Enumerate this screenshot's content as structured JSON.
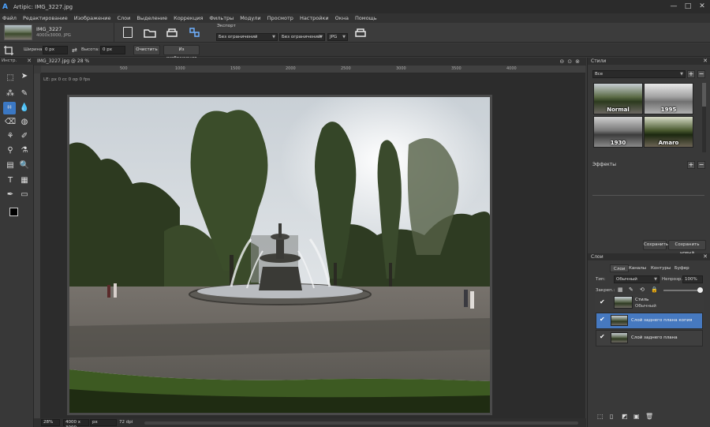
{
  "window": {
    "title": "Artipic: IMG_3227.jpg",
    "controls": [
      "—",
      "□",
      "✕"
    ]
  },
  "menu": [
    "Файл",
    "Редактирование",
    "Изображение",
    "Слои",
    "Выделение",
    "Коррекция",
    "Фильтры",
    "Модули",
    "Просмотр",
    "Настройки",
    "Окна",
    "Помощь"
  ],
  "topbar": {
    "thumb_name": "IMG_3227",
    "thumb_info": "4000x3000, JPG",
    "export_label": "Экспорт",
    "export_size1": "Без ограничений",
    "export_size2": "Без ограничений",
    "export_format": "JPG"
  },
  "options": {
    "width_label": "Ширина:",
    "width_value": "0 px",
    "height_label": "Высота:",
    "height_value": "0 px",
    "clear_button": "Очистить",
    "from_image_button": "Из изображения"
  },
  "toolbox": {
    "header": "Инстр."
  },
  "document": {
    "tab_title": "IMG_3227.jpg @ 28 %",
    "ruler_note": "LE: px 0 cc 0 op 0 fps",
    "ruler_ticks": [
      "500",
      "1000",
      "1500",
      "2000",
      "2500",
      "3000",
      "3500",
      "4000"
    ]
  },
  "statusbar": {
    "zoom": "28%",
    "size": "4000 x 3000",
    "unit": "px",
    "dpi": "72 dpi"
  },
  "styles_panel": {
    "title": "Стили",
    "filter": "Все",
    "thumbs": [
      "Normal",
      "1995",
      "1930",
      "Amaro"
    ],
    "effects_label": "Эффекты",
    "save_button": "Сохранить",
    "save_new_button": "Сохранить новый"
  },
  "layers_panel": {
    "title": "Слои",
    "tabs": [
      "Слои",
      "Каналы",
      "Контуры",
      "Буфер"
    ],
    "type_label": "Тип:",
    "blend_mode": "Обычный",
    "opacity_label": "Непрозр.:",
    "opacity_value": "100%",
    "lock_label": "Закреп.:",
    "layers": [
      {
        "name": "Стиль",
        "sub": "Обычный",
        "checked": true,
        "selected": false
      },
      {
        "name": "Слой заднего плана копия",
        "checked": true,
        "selected": true
      },
      {
        "name": "Слой заднего плана",
        "checked": true,
        "selected": false
      }
    ]
  },
  "colors": {
    "accent": "#4679c0",
    "active_tool": "#3b78c4"
  }
}
